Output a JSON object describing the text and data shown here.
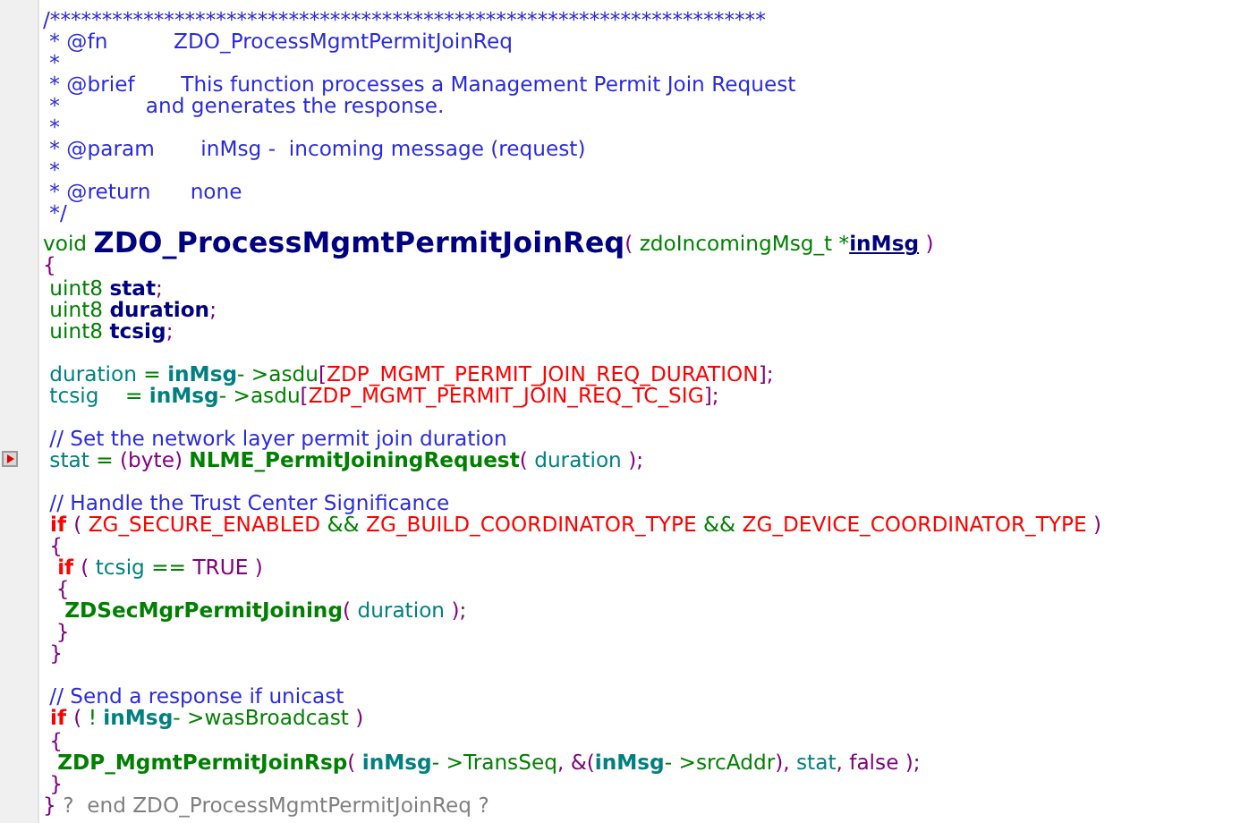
{
  "editor": {
    "lines": [
      {
        "breakpoint": false,
        "tokens": [
          {
            "kind": "comment",
            "text": "/*********************************************************************"
          }
        ]
      },
      {
        "breakpoint": false,
        "tokens": [
          {
            "kind": "comment",
            "text": " * @fn          ZDO_ProcessMgmtPermitJoinReq"
          }
        ]
      },
      {
        "breakpoint": false,
        "tokens": [
          {
            "kind": "comment",
            "text": " *"
          }
        ]
      },
      {
        "breakpoint": false,
        "tokens": [
          {
            "kind": "comment",
            "text": " * @brief       This function processes a Management Permit Join Request"
          }
        ]
      },
      {
        "breakpoint": false,
        "tokens": [
          {
            "kind": "comment",
            "text": " *             and generates the response."
          }
        ]
      },
      {
        "breakpoint": false,
        "tokens": [
          {
            "kind": "comment",
            "text": " *"
          }
        ]
      },
      {
        "breakpoint": false,
        "tokens": [
          {
            "kind": "comment",
            "text": " * @param       inMsg -  incoming message (request)"
          }
        ]
      },
      {
        "breakpoint": false,
        "tokens": [
          {
            "kind": "comment",
            "text": " *"
          }
        ]
      },
      {
        "breakpoint": false,
        "tokens": [
          {
            "kind": "comment",
            "text": " * @return      none"
          }
        ]
      },
      {
        "breakpoint": false,
        "tokens": [
          {
            "kind": "comment",
            "text": " */"
          }
        ]
      },
      {
        "breakpoint": false,
        "tokens": [
          {
            "kind": "type",
            "text": "void "
          },
          {
            "kind": "fname",
            "text": "ZDO_ProcessMgmtPermitJoinReq"
          },
          {
            "kind": "punct",
            "text": "( "
          },
          {
            "kind": "type",
            "text": "zdoIncomingMsg_t "
          },
          {
            "kind": "op",
            "text": "*"
          },
          {
            "kind": "param",
            "text": "inMsg"
          },
          {
            "kind": "punct",
            "text": " )"
          }
        ]
      },
      {
        "breakpoint": false,
        "tokens": [
          {
            "kind": "punct",
            "text": "{"
          }
        ]
      },
      {
        "breakpoint": false,
        "tokens": [
          {
            "kind": "type",
            "text": " uint8 "
          },
          {
            "kind": "decl",
            "text": "stat"
          },
          {
            "kind": "punct",
            "text": ";"
          }
        ]
      },
      {
        "breakpoint": false,
        "tokens": [
          {
            "kind": "type",
            "text": " uint8 "
          },
          {
            "kind": "decl",
            "text": "duration"
          },
          {
            "kind": "punct",
            "text": ";"
          }
        ]
      },
      {
        "breakpoint": false,
        "tokens": [
          {
            "kind": "type",
            "text": " uint8 "
          },
          {
            "kind": "decl",
            "text": "tcsig"
          },
          {
            "kind": "punct",
            "text": ";"
          }
        ]
      },
      {
        "kind": "blank"
      },
      {
        "breakpoint": false,
        "tokens": [
          {
            "kind": "var",
            "text": " duration "
          },
          {
            "kind": "op",
            "text": "= "
          },
          {
            "kind": "varbold",
            "text": "inMsg"
          },
          {
            "kind": "op",
            "text": "- >"
          },
          {
            "kind": "member",
            "text": "asdu"
          },
          {
            "kind": "punct",
            "text": "["
          },
          {
            "kind": "macro",
            "text": "ZDP_MGMT_PERMIT_JOIN_REQ_DURATION"
          },
          {
            "kind": "punct",
            "text": "];"
          }
        ]
      },
      {
        "breakpoint": false,
        "tokens": [
          {
            "kind": "var",
            "text": " tcsig    "
          },
          {
            "kind": "op",
            "text": "= "
          },
          {
            "kind": "varbold",
            "text": "inMsg"
          },
          {
            "kind": "op",
            "text": "- >"
          },
          {
            "kind": "member",
            "text": "asdu"
          },
          {
            "kind": "punct",
            "text": "["
          },
          {
            "kind": "macro",
            "text": "ZDP_MGMT_PERMIT_JOIN_REQ_TC_SIG"
          },
          {
            "kind": "punct",
            "text": "];"
          }
        ]
      },
      {
        "kind": "blank"
      },
      {
        "breakpoint": false,
        "tokens": [
          {
            "kind": "comment",
            "text": " // Set the network layer permit join duration"
          }
        ]
      },
      {
        "breakpoint": true,
        "tokens": [
          {
            "kind": "var",
            "text": " stat "
          },
          {
            "kind": "op",
            "text": "= "
          },
          {
            "kind": "punct",
            "text": "("
          },
          {
            "kind": "const",
            "text": "byte"
          },
          {
            "kind": "punct",
            "text": ") "
          },
          {
            "kind": "func",
            "text": "NLME_PermitJoiningRequest"
          },
          {
            "kind": "punct",
            "text": "( "
          },
          {
            "kind": "var",
            "text": "duration "
          },
          {
            "kind": "punct",
            "text": ");"
          }
        ]
      },
      {
        "kind": "blank"
      },
      {
        "breakpoint": false,
        "tokens": [
          {
            "kind": "comment",
            "text": " // Handle the Trust Center Significance"
          }
        ]
      },
      {
        "breakpoint": false,
        "tokens": [
          {
            "kind": "keyword",
            "text": " if "
          },
          {
            "kind": "punct",
            "text": "( "
          },
          {
            "kind": "macro",
            "text": "ZG_SECURE_ENABLED "
          },
          {
            "kind": "op",
            "text": "&& "
          },
          {
            "kind": "macro",
            "text": "ZG_BUILD_COORDINATOR_TYPE "
          },
          {
            "kind": "op",
            "text": "&& "
          },
          {
            "kind": "macro",
            "text": "ZG_DEVICE_COORDINATOR_TYPE "
          },
          {
            "kind": "punct",
            "text": ")"
          }
        ]
      },
      {
        "breakpoint": false,
        "tokens": [
          {
            "kind": "punct",
            "text": " {"
          }
        ]
      },
      {
        "breakpoint": false,
        "tokens": [
          {
            "kind": "keyword",
            "text": "  if "
          },
          {
            "kind": "punct",
            "text": "( "
          },
          {
            "kind": "var",
            "text": "tcsig "
          },
          {
            "kind": "op",
            "text": "== "
          },
          {
            "kind": "const",
            "text": "TRUE "
          },
          {
            "kind": "punct",
            "text": ")"
          }
        ]
      },
      {
        "breakpoint": false,
        "tokens": [
          {
            "kind": "punct",
            "text": "  {"
          }
        ]
      },
      {
        "breakpoint": false,
        "tokens": [
          {
            "kind": "func",
            "text": "   ZDSecMgrPermitJoining"
          },
          {
            "kind": "punct",
            "text": "( "
          },
          {
            "kind": "var",
            "text": "duration "
          },
          {
            "kind": "punct",
            "text": ");"
          }
        ]
      },
      {
        "breakpoint": false,
        "tokens": [
          {
            "kind": "punct",
            "text": "  }"
          }
        ]
      },
      {
        "breakpoint": false,
        "tokens": [
          {
            "kind": "punct",
            "text": " }"
          }
        ]
      },
      {
        "kind": "blank"
      },
      {
        "breakpoint": false,
        "tokens": [
          {
            "kind": "comment",
            "text": " // Send a response if unicast"
          }
        ]
      },
      {
        "breakpoint": false,
        "tokens": [
          {
            "kind": "keyword",
            "text": " if "
          },
          {
            "kind": "punct",
            "text": "( "
          },
          {
            "kind": "op",
            "text": "! "
          },
          {
            "kind": "varbold",
            "text": "inMsg"
          },
          {
            "kind": "op",
            "text": "- >"
          },
          {
            "kind": "member",
            "text": "wasBroadcast "
          },
          {
            "kind": "punct",
            "text": ")"
          }
        ]
      },
      {
        "breakpoint": false,
        "tokens": [
          {
            "kind": "punct",
            "text": " {"
          }
        ]
      },
      {
        "breakpoint": false,
        "tokens": [
          {
            "kind": "func",
            "text": "  ZDP_MgmtPermitJoinRsp"
          },
          {
            "kind": "punct",
            "text": "( "
          },
          {
            "kind": "varbold",
            "text": "inMsg"
          },
          {
            "kind": "op",
            "text": "- >"
          },
          {
            "kind": "member",
            "text": "TransSeq"
          },
          {
            "kind": "punct",
            "text": ", &("
          },
          {
            "kind": "varbold",
            "text": "inMsg"
          },
          {
            "kind": "op",
            "text": "- >"
          },
          {
            "kind": "member",
            "text": "srcAddr"
          },
          {
            "kind": "punct",
            "text": "), "
          },
          {
            "kind": "var",
            "text": "stat"
          },
          {
            "kind": "punct",
            "text": ", "
          },
          {
            "kind": "const",
            "text": "false "
          },
          {
            "kind": "punct",
            "text": ");"
          }
        ]
      },
      {
        "breakpoint": false,
        "tokens": [
          {
            "kind": "punct",
            "text": " }"
          }
        ]
      },
      {
        "breakpoint": false,
        "tokens": [
          {
            "kind": "punct",
            "text": "} "
          },
          {
            "kind": "gray",
            "text": "?  end ZDO_ProcessMgmtPermitJoinReq ?"
          }
        ]
      }
    ]
  }
}
